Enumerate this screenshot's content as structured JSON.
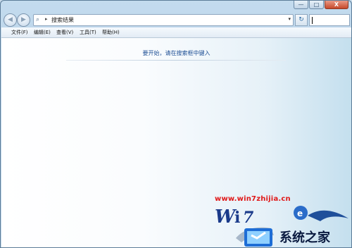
{
  "address": {
    "path": "搜索结果"
  },
  "menu": [
    "文件(F)",
    "编辑(E)",
    "查看(V)",
    "工具(T)",
    "帮助(H)"
  ],
  "content": {
    "message": "要开始，请在搜索框中键入"
  },
  "watermark": {
    "url": "www.win7zhijia.cn",
    "logo_text": "系统之家"
  },
  "caption": {
    "minimize": "—",
    "maximize": "□",
    "close": "X"
  }
}
